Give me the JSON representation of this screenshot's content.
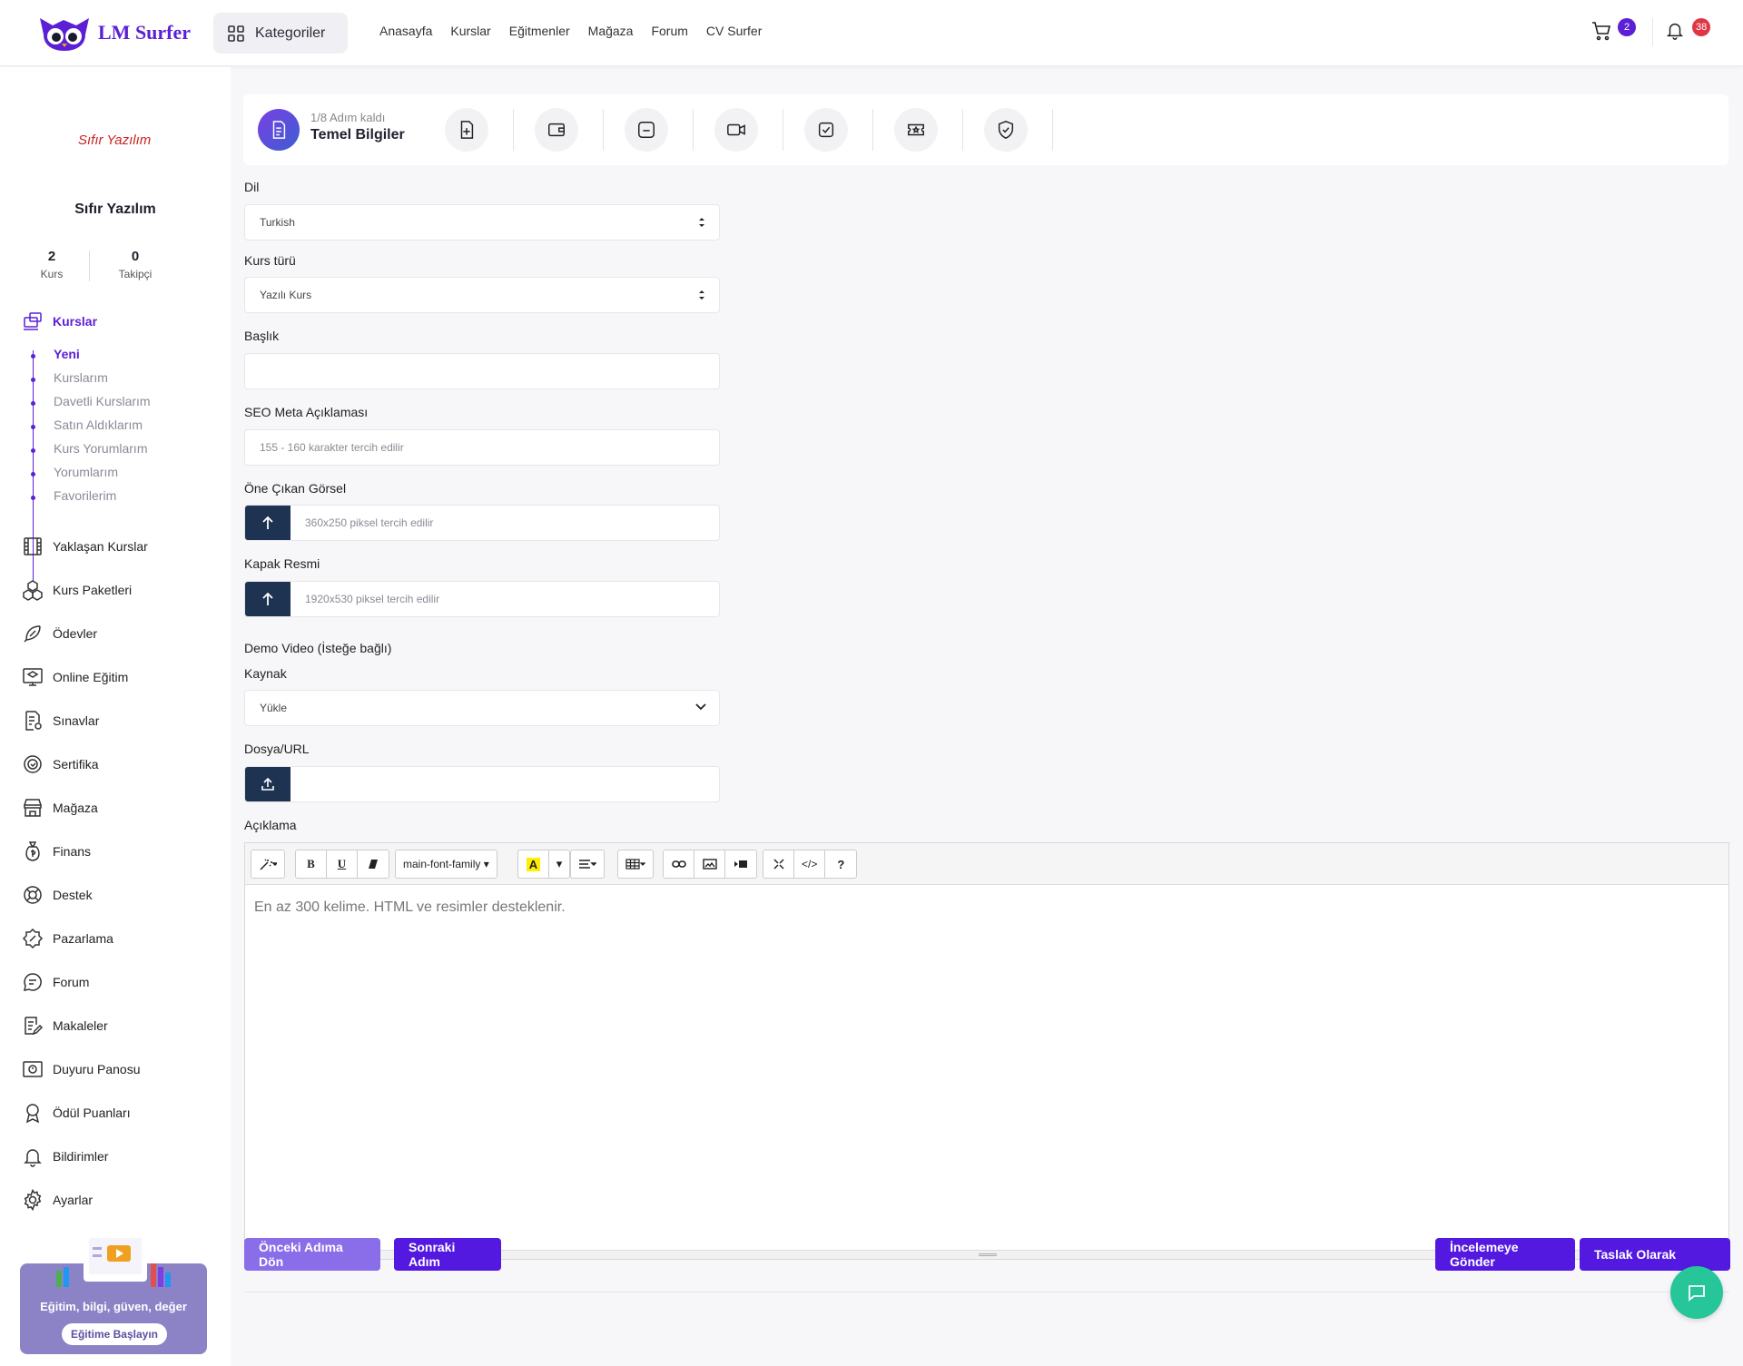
{
  "header": {
    "logo_text": "LM Surfer",
    "categories_label": "Kategoriler",
    "nav": [
      "Anasayfa",
      "Kurslar",
      "Eğitmenler",
      "Mağaza",
      "Forum",
      "CV Surfer"
    ],
    "cart_count": "2",
    "notification_count": "38"
  },
  "sidebar": {
    "brand_logo": "Sıfır Yazılım",
    "brand_name": "Sıfır Yazılım",
    "stats": [
      {
        "value": "2",
        "label": "Kurs"
      },
      {
        "value": "0",
        "label": "Takipçi"
      }
    ],
    "courses_label": "Kurslar",
    "course_sub": [
      "Yeni",
      "Kurslarım",
      "Davetli Kurslarım",
      "Satın Aldıklarım",
      "Kurs Yorumlarım",
      "Yorumlarım",
      "Favorilerim"
    ],
    "items": [
      "Yaklaşan Kurslar",
      "Kurs Paketleri",
      "Ödevler",
      "Online Eğitim",
      "Sınavlar",
      "Sertifika",
      "Mağaza",
      "Finans",
      "Destek",
      "Pazarlama",
      "Forum",
      "Makaleler",
      "Duyuru Panosu",
      "Ödül Puanları",
      "Bildirimler",
      "Ayarlar"
    ],
    "promo_title": "Eğitim, bilgi, güven, değer",
    "promo_button": "Eğitime Başlayın"
  },
  "stepper": {
    "progress": "1/8 Adım kaldı",
    "current_step": "Temel Bilgiler",
    "icons": [
      "file-plus-icon",
      "wallet-icon",
      "folder-icon",
      "video-icon",
      "checklist-icon",
      "ticket-icon",
      "shield-check-icon"
    ]
  },
  "form": {
    "language_label": "Dil",
    "language_value": "Turkish",
    "course_type_label": "Kurs türü",
    "course_type_value": "Yazılı Kurs",
    "title_label": "Başlık",
    "title_value": "",
    "seo_label": "SEO Meta Açıklaması",
    "seo_placeholder": "155 - 160 karakter tercih edilir",
    "thumbnail_label": "Öne Çıkan Görsel",
    "thumbnail_placeholder": "360x250 piksel tercih edilir",
    "cover_label": "Kapak Resmi",
    "cover_placeholder": "1920x530 piksel tercih edilir",
    "demo_video_label": "Demo Video (İsteğe bağlı)",
    "source_label": "Kaynak",
    "source_value": "Yükle",
    "file_label": "Dosya/URL",
    "description_label": "Açıklama",
    "description_placeholder": "En az 300 kelime. HTML ve resimler desteklenir.",
    "font_family": "main-font-family"
  },
  "buttons": {
    "prev": "Önceki Adıma Dön",
    "next": "Sonraki Adım",
    "review": "İncelemeye Gönder",
    "draft": "Taslak Olarak"
  },
  "colors": {
    "accent": "#5b1fd6",
    "dark_upload": "#1e3352",
    "chat": "#27c59a"
  }
}
